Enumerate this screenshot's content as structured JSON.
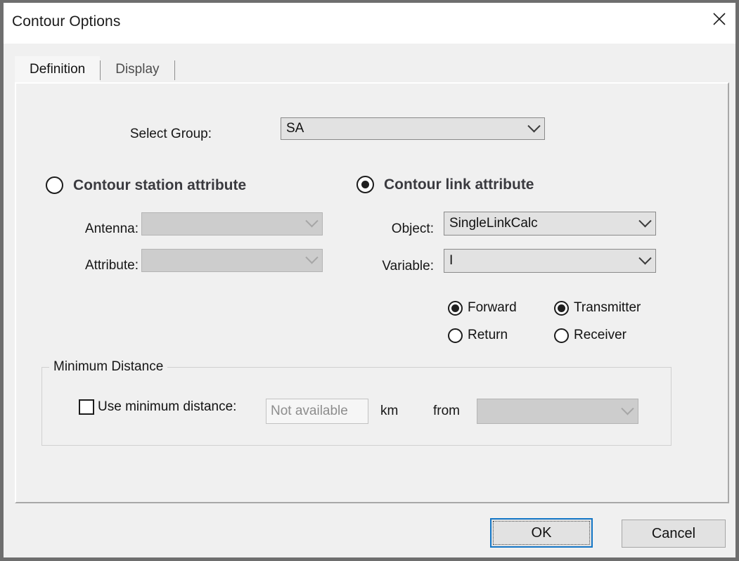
{
  "window": {
    "title": "Contour Options",
    "close_icon": "close-icon"
  },
  "tabs": [
    {
      "label": "Definition",
      "active": true
    },
    {
      "label": "Display",
      "active": false
    }
  ],
  "form": {
    "select_group": {
      "label": "Select Group:",
      "value": "SA",
      "enabled": true
    },
    "station_attribute": {
      "label": "Contour station attribute",
      "selected": false,
      "fields": [
        {
          "label": "Antenna:",
          "value": "",
          "enabled": false
        },
        {
          "label": "Attribute:",
          "value": "",
          "enabled": false
        }
      ]
    },
    "link_attribute": {
      "label": "Contour link attribute",
      "selected": true,
      "fields": [
        {
          "label": "Object:",
          "value": "SingleLinkCalc",
          "enabled": true
        },
        {
          "label": "Variable:",
          "value": "I",
          "enabled": true
        }
      ],
      "direction_options": [
        {
          "label": "Forward",
          "selected": true
        },
        {
          "label": "Return",
          "selected": false
        }
      ],
      "endpoint_options": [
        {
          "label": "Transmitter",
          "selected": true
        },
        {
          "label": "Receiver",
          "selected": false
        }
      ]
    },
    "minimum_distance": {
      "title": "Minimum Distance",
      "checkbox_label": "Use minimum distance:",
      "checked": false,
      "distance_placeholder": "Not available",
      "unit_label": "km",
      "from_label": "from",
      "from_value": "",
      "from_enabled": false
    }
  },
  "buttons": {
    "ok": "OK",
    "cancel": "Cancel"
  },
  "colors": {
    "accent": "#1577c6",
    "dialog_background": "#f0f0f0",
    "titlebar_background": "#ffffff",
    "disabled_field": "#cdcdcd"
  }
}
